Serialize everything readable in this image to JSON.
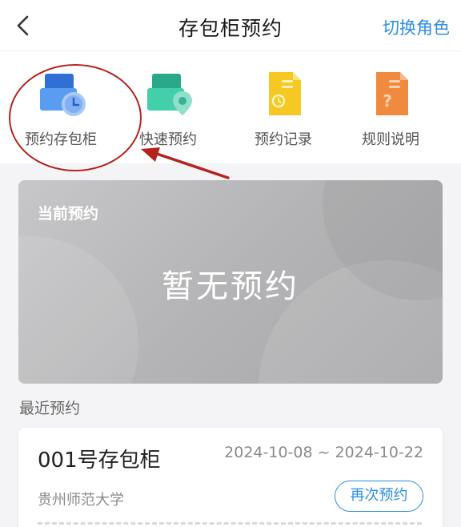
{
  "navbar": {
    "title": "存包柜预约",
    "switch_label": "切换角色",
    "back_icon": "chevron-left-icon"
  },
  "menu": {
    "items": [
      {
        "label": "预约存包柜",
        "icon": "locker-clock-icon",
        "color": "#3d8ae8"
      },
      {
        "label": "快速预约",
        "icon": "locker-pin-icon",
        "color": "#37c7a3"
      },
      {
        "label": "预约记录",
        "icon": "record-document-icon",
        "color": "#f4c22c"
      },
      {
        "label": "规则说明",
        "icon": "rules-document-icon",
        "color": "#f08a3e"
      }
    ]
  },
  "current": {
    "label": "当前预约",
    "empty_text": "暂无预约"
  },
  "recent": {
    "title": "最近预约",
    "items": [
      {
        "locker": "001号存包柜",
        "date_range": "2024-10-08 ~ 2024-10-22",
        "school": "贵州师范大学",
        "button_label": "再次预约"
      }
    ]
  },
  "colors": {
    "accent": "#2c8ee6",
    "annotation": "#b5231f",
    "card_gray": "#b4b4b6"
  }
}
